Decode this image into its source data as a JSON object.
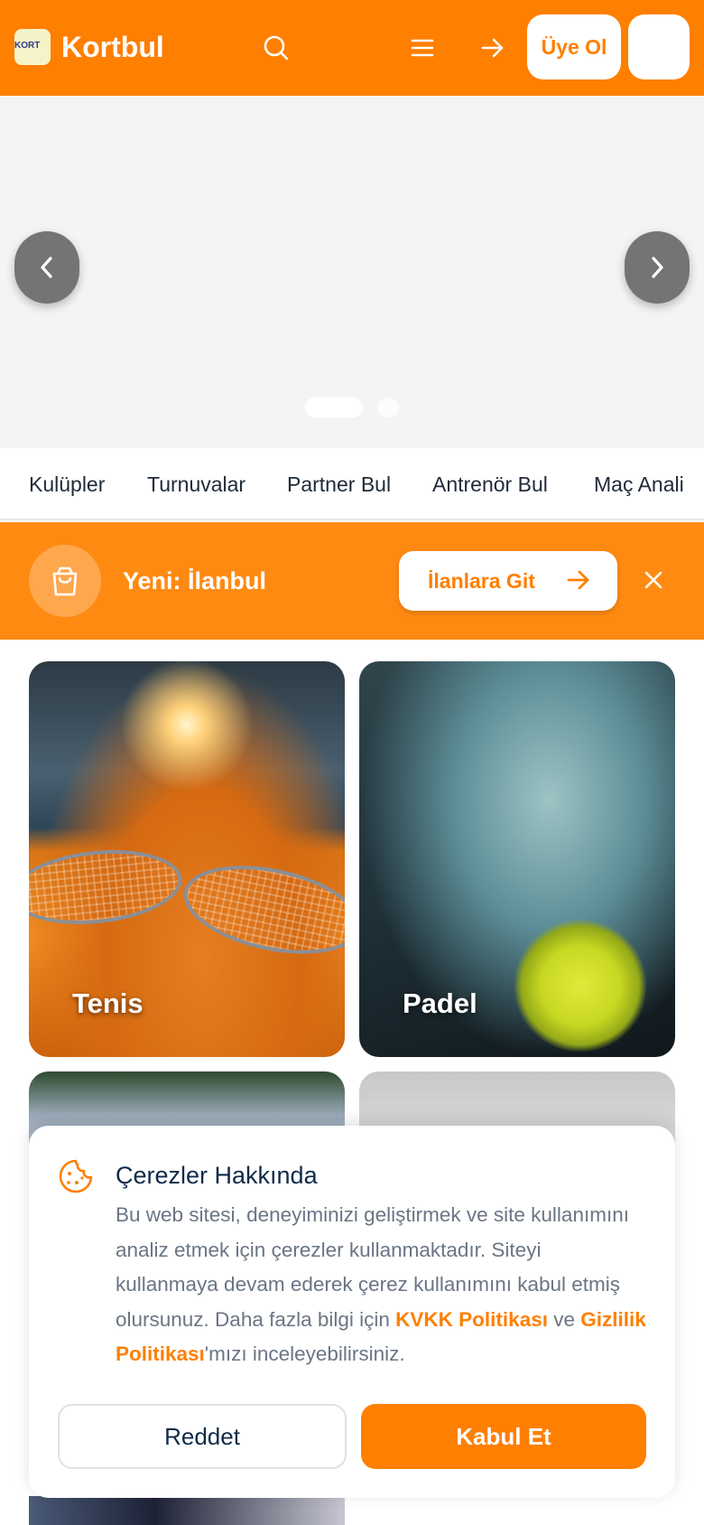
{
  "header": {
    "brand": "Kortbul",
    "logo_text": "KORT",
    "signup_label": "Üye Ol"
  },
  "nav_tabs": [
    "Kulüpler",
    "Turnuvalar",
    "Partner Bul",
    "Antrenör Bul",
    "Maç Anali"
  ],
  "banner": {
    "title": "Yeni: İlanbul",
    "button_label": "İlanlara Git"
  },
  "cards": [
    {
      "label": "Tenis"
    },
    {
      "label": "Padel"
    }
  ],
  "cookie": {
    "title": "Çerezler Hakkında",
    "text_part1": "Bu web sitesi, deneyiminizi geliştirmek ve site kullanımını analiz etmek için çerezler kullanmaktadır. Siteyi kullanmaya devam ederek çerez kullanımını kabul etmiş olursunuz. Daha fazla bilgi için ",
    "link_kvkk": "KVKK Politikası",
    "text_part2": " ve ",
    "link_privacy": "Gizlilik Politikası",
    "text_part3": "'mızı inceleyebilirsiniz.",
    "reject_label": "Reddet",
    "accept_label": "Kabul Et"
  },
  "colors": {
    "brand": "#ff7f00",
    "text_dark": "#102a48",
    "text_muted": "#6a7585"
  }
}
